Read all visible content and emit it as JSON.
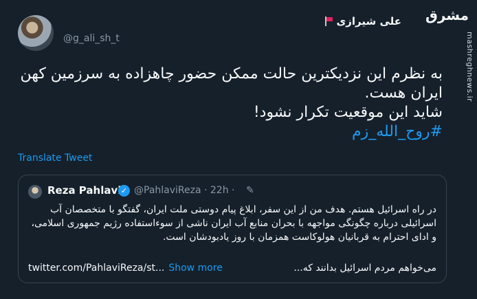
{
  "header": {
    "name": "علی شیرازی",
    "handle": "@g_ali_sh_t",
    "logo": "مشرق",
    "side_url": "mashreghnews.ir"
  },
  "tweet": {
    "line1": "به نظرم این نزدیکترین حالت ممکن حضور چاهزاده به سرزمین کهن ایران هست.",
    "line2": "شاید این موقعیت تکرار نشود!",
    "hashtag": "#روح_الله_زم",
    "translate_label": "Translate Tweet"
  },
  "quoted": {
    "name": "Reza Pahlavi",
    "handle_time": "@PahlaviReza · 22h ·",
    "body": "در راه اسرائیل هستم. هدف من از این سفر، ابلاغ پیام دوستی ملت ایران، گفتگو با متخصصان آب اسرائیلی درباره چگونگی مواجهه با بحران منابع آب ایران ناشی از سوءاستفاده رژیم جمهوری اسلامی، و ادای احترام به قربانیان هولوکاست همزمان با روز یادبودشان است.",
    "last_rtl": "می‌خواهم مردم اسرائیل بدانند که...",
    "link": "twitter.com/PahlaviReza/st...",
    "show_more": "Show more"
  },
  "colors": {
    "background": "#15202b",
    "accent": "#1d9bf0",
    "muted": "#8b98a5"
  }
}
